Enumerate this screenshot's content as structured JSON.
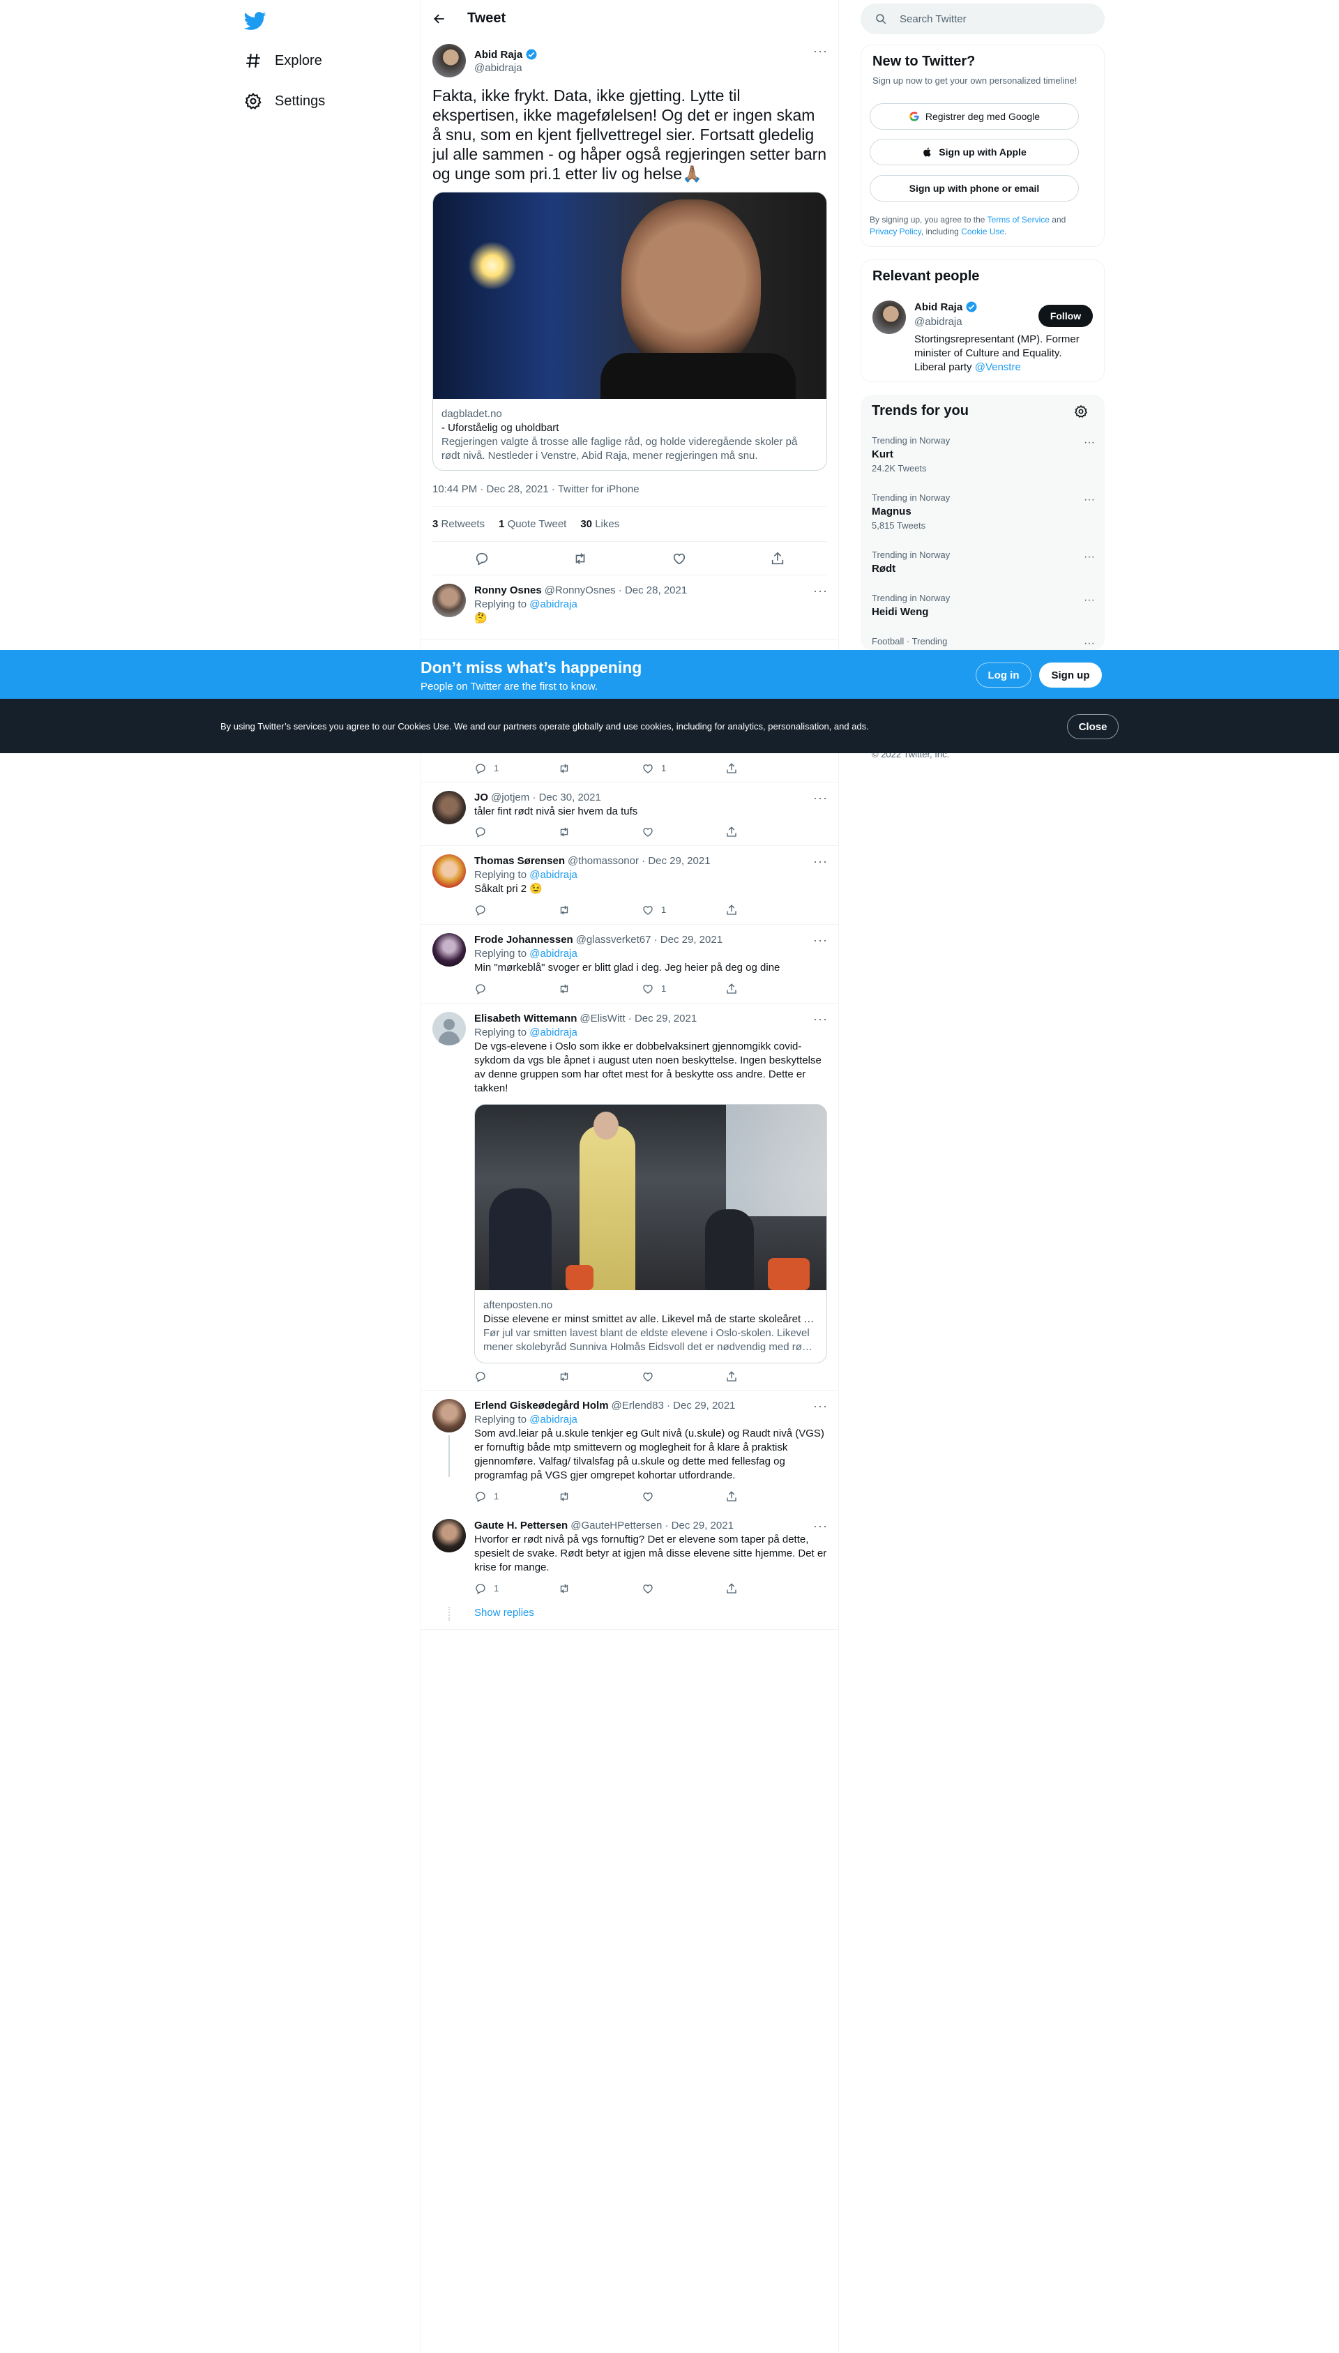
{
  "nav": {
    "explore": "Explore",
    "settings": "Settings"
  },
  "header": {
    "title": "Tweet"
  },
  "tweet": {
    "name": "Abid Raja",
    "handle": "@abidraja",
    "text": "Fakta, ikke frykt. Data, ikke gjetting. Lytte til ekspertisen, ikke magefølelsen! Og det er ingen skam å snu, som en kjent fjellvettregel sier. Fortsatt gledelig jul alle sammen - og håper også regjeringen setter barn og unge som pri.1 etter liv og helse🙏🏽",
    "card": {
      "domain": "dagbladet.no",
      "title": "- Uforståelig og uholdbart",
      "desc": "Regjeringen valgte å trosse alle faglige råd, og holde videregående skoler på rødt nivå. Nestleder i Venstre, Abid Raja, mener regjeringen må snu."
    },
    "timestamp": "10:44 PM · Dec 28, 2021 · Twitter for iPhone",
    "retweets": "3",
    "retweets_label": "Retweets",
    "quotes": "1",
    "quotes_label": "Quote Tweet",
    "likes": "30",
    "likes_label": "Likes"
  },
  "replies": [
    {
      "name": "Ronny Osnes",
      "meta": "@RonnyOsnes · Dec 28, 2021",
      "replying": "Replying to",
      "to": "@abidraja",
      "text": "🤔",
      "reply_count": "",
      "rt_count": "",
      "like_count": ""
    },
    {
      "name": "",
      "meta": "",
      "replying": "",
      "to": "",
      "text": "",
      "reply_count": "1",
      "rt_count": "",
      "like_count": "1"
    },
    {
      "name": "JO",
      "meta": "@jotjem · Dec 30, 2021",
      "replying": "",
      "to": "",
      "text": "tåler fint rødt nivå sier hvem da tufs",
      "reply_count": "",
      "rt_count": "",
      "like_count": ""
    },
    {
      "name": "Thomas Sørensen",
      "meta": "@thomassonor · Dec 29, 2021",
      "replying": "Replying to",
      "to": "@abidraja",
      "text": "Såkalt pri 2 😉",
      "reply_count": "",
      "rt_count": "",
      "like_count": "1"
    },
    {
      "name": "Frode Johannessen",
      "meta": "@glassverket67 · Dec 29, 2021",
      "replying": "Replying to",
      "to": "@abidraja",
      "text": "Min \"mørkeblå\" svoger er blitt glad i deg. Jeg heier på deg og dine",
      "reply_count": "",
      "rt_count": "",
      "like_count": "1"
    },
    {
      "name": "Elisabeth Wittemann",
      "meta": "@ElisWitt · Dec 29, 2021",
      "replying": "Replying to",
      "to": "@abidraja",
      "text": "De vgs-elevene i Oslo som ikke er dobbelvaksinert gjennomgikk covid-sykdom da vgs ble åpnet i august uten noen beskyttelse. Ingen beskyttelse av denne gruppen som har oftet mest for å beskytte oss andre. Dette er takken!",
      "card_domain": "aftenposten.no",
      "card_title": "Disse elevene er minst smittet av alle. Likevel må de starte skoleåret på rødt nivå.",
      "card_desc": "Før jul var smitten lavest blant de eldste elevene i Oslo-skolen. Likevel mener skolebyråd Sunniva Holmås Eidsvoll det er nødvendig med rødt nivå."
    },
    {
      "name": "Erlend Giskeødegård Holm",
      "meta": "@Erlend83 · Dec 29, 2021",
      "replying": "Replying to",
      "to": "@abidraja",
      "text": "Som avd.leiar på u.skule tenkjer eg Gult nivå (u.skule) og Raudt nivå (VGS) er fornuftig både mtp smittevern og moglegheit for å klare å praktisk gjennomføre. Valfag/ tilvalsfag på u.skule og dette med fellesfag og programfag på VGS gjer omgrepet kohortar utfordrande.",
      "reply_count": "1",
      "rt_count": "",
      "like_count": ""
    },
    {
      "name": "Gaute H. Pettersen",
      "meta": "@GauteHPettersen · Dec 29, 2021",
      "replying": "",
      "to": "",
      "text": "Hvorfor er rødt nivå på vgs fornuftig? Det er elevene som taper på dette, spesielt de svake. Rødt betyr at igjen må disse elevene sitte hjemme. Det er krise for mange.",
      "reply_count": "1",
      "rt_count": "",
      "like_count": ""
    }
  ],
  "show_replies": "Show replies",
  "search": {
    "placeholder": "Search Twitter"
  },
  "new_to_twitter": {
    "title": "New to Twitter?",
    "sub": "Sign up now to get your own personalized timeline!",
    "google": "Registrer deg med Google",
    "apple": "Sign up with Apple",
    "phone": "Sign up with phone or email",
    "legal_1": "By signing up, you agree to the",
    "tos": "Terms of Service",
    "and": "and",
    "privacy": "Privacy Policy",
    "including": ", including",
    "cookie": "Cookie Use",
    "dot": "."
  },
  "relevant": {
    "title": "Relevant people",
    "name": "Abid Raja",
    "handle": "@abidraja",
    "follow": "Follow",
    "bio": "Stortingsrepresentant (MP). Former minister of Culture and Equality. Liberal party",
    "bio_link": "@Venstre"
  },
  "trends": {
    "title": "Trends for you",
    "items": [
      {
        "context": "Trending in Norway",
        "name": "Kurt",
        "tweets": "24.2K Tweets"
      },
      {
        "context": "Trending in Norway",
        "name": "Magnus",
        "tweets": "5,815 Tweets"
      },
      {
        "context": "Trending in Norway",
        "name": "Rødt",
        "tweets": ""
      },
      {
        "context": "Trending in Norway",
        "name": "Heidi Weng",
        "tweets": ""
      },
      {
        "context": "Football · Trending",
        "name": "",
        "tweets": ""
      }
    ]
  },
  "copyright": "© 2022 Twitter, Inc.",
  "banner": {
    "title": "Don’t miss what’s happening",
    "sub": "People on Twitter are the first to know.",
    "login": "Log in",
    "signup": "Sign up"
  },
  "cookie_bar": {
    "text": "By using Twitter’s services you agree to our Cookies Use. We and our partners operate globally and use cookies, including for analytics, personalisation, and ads.",
    "close": "Close"
  },
  "colors": {
    "brand": "#1d9bf0",
    "dark": "#15202b",
    "text": "#0f1419",
    "muted": "#536471"
  }
}
